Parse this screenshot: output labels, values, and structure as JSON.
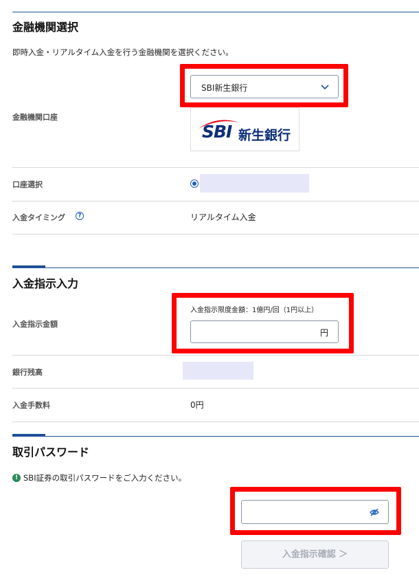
{
  "bank_section": {
    "title": "金融機関選択",
    "description": "即時入金・リアルタイム入金を行う金融機関を選択ください。",
    "account_label": "金融機関口座",
    "selected_bank": "SBI新生銀行",
    "logo_main": "SBI",
    "logo_sub": "新生銀行",
    "account_select_label": "口座選択",
    "timing_label": "入金タイミング",
    "timing_help_icon": "?",
    "timing_value": "リアルタイム入金"
  },
  "deposit_section": {
    "title": "入金指示入力",
    "amount_label": "入金指示金額",
    "limit_text": "入金指示限度金額：1億円/回（1円以上）",
    "amount_placeholder": "",
    "currency_unit": "円",
    "bank_balance_label": "銀行残高",
    "fee_label": "入金手数料",
    "fee_value": "0円"
  },
  "password_section": {
    "title": "取引パスワード",
    "info_icon": "!",
    "info_text": "SBI証券の取引パスワードをご入力ください。",
    "password_placeholder": ""
  },
  "confirm_button": {
    "label": "入金指示確認 ＞"
  },
  "colors": {
    "accent": "#1f4f96",
    "highlight_frame": "#ff0000",
    "masked_field": "#e6e7f8",
    "info_green": "#2b8a5a",
    "logo_red": "#e60012",
    "logo_navy": "#0b2f78"
  },
  "icons": {
    "select_chevron": "chevron-down-icon",
    "password_toggle": "eye-off-icon",
    "help": "question-circle-icon",
    "info": "exclamation-circle-icon"
  }
}
